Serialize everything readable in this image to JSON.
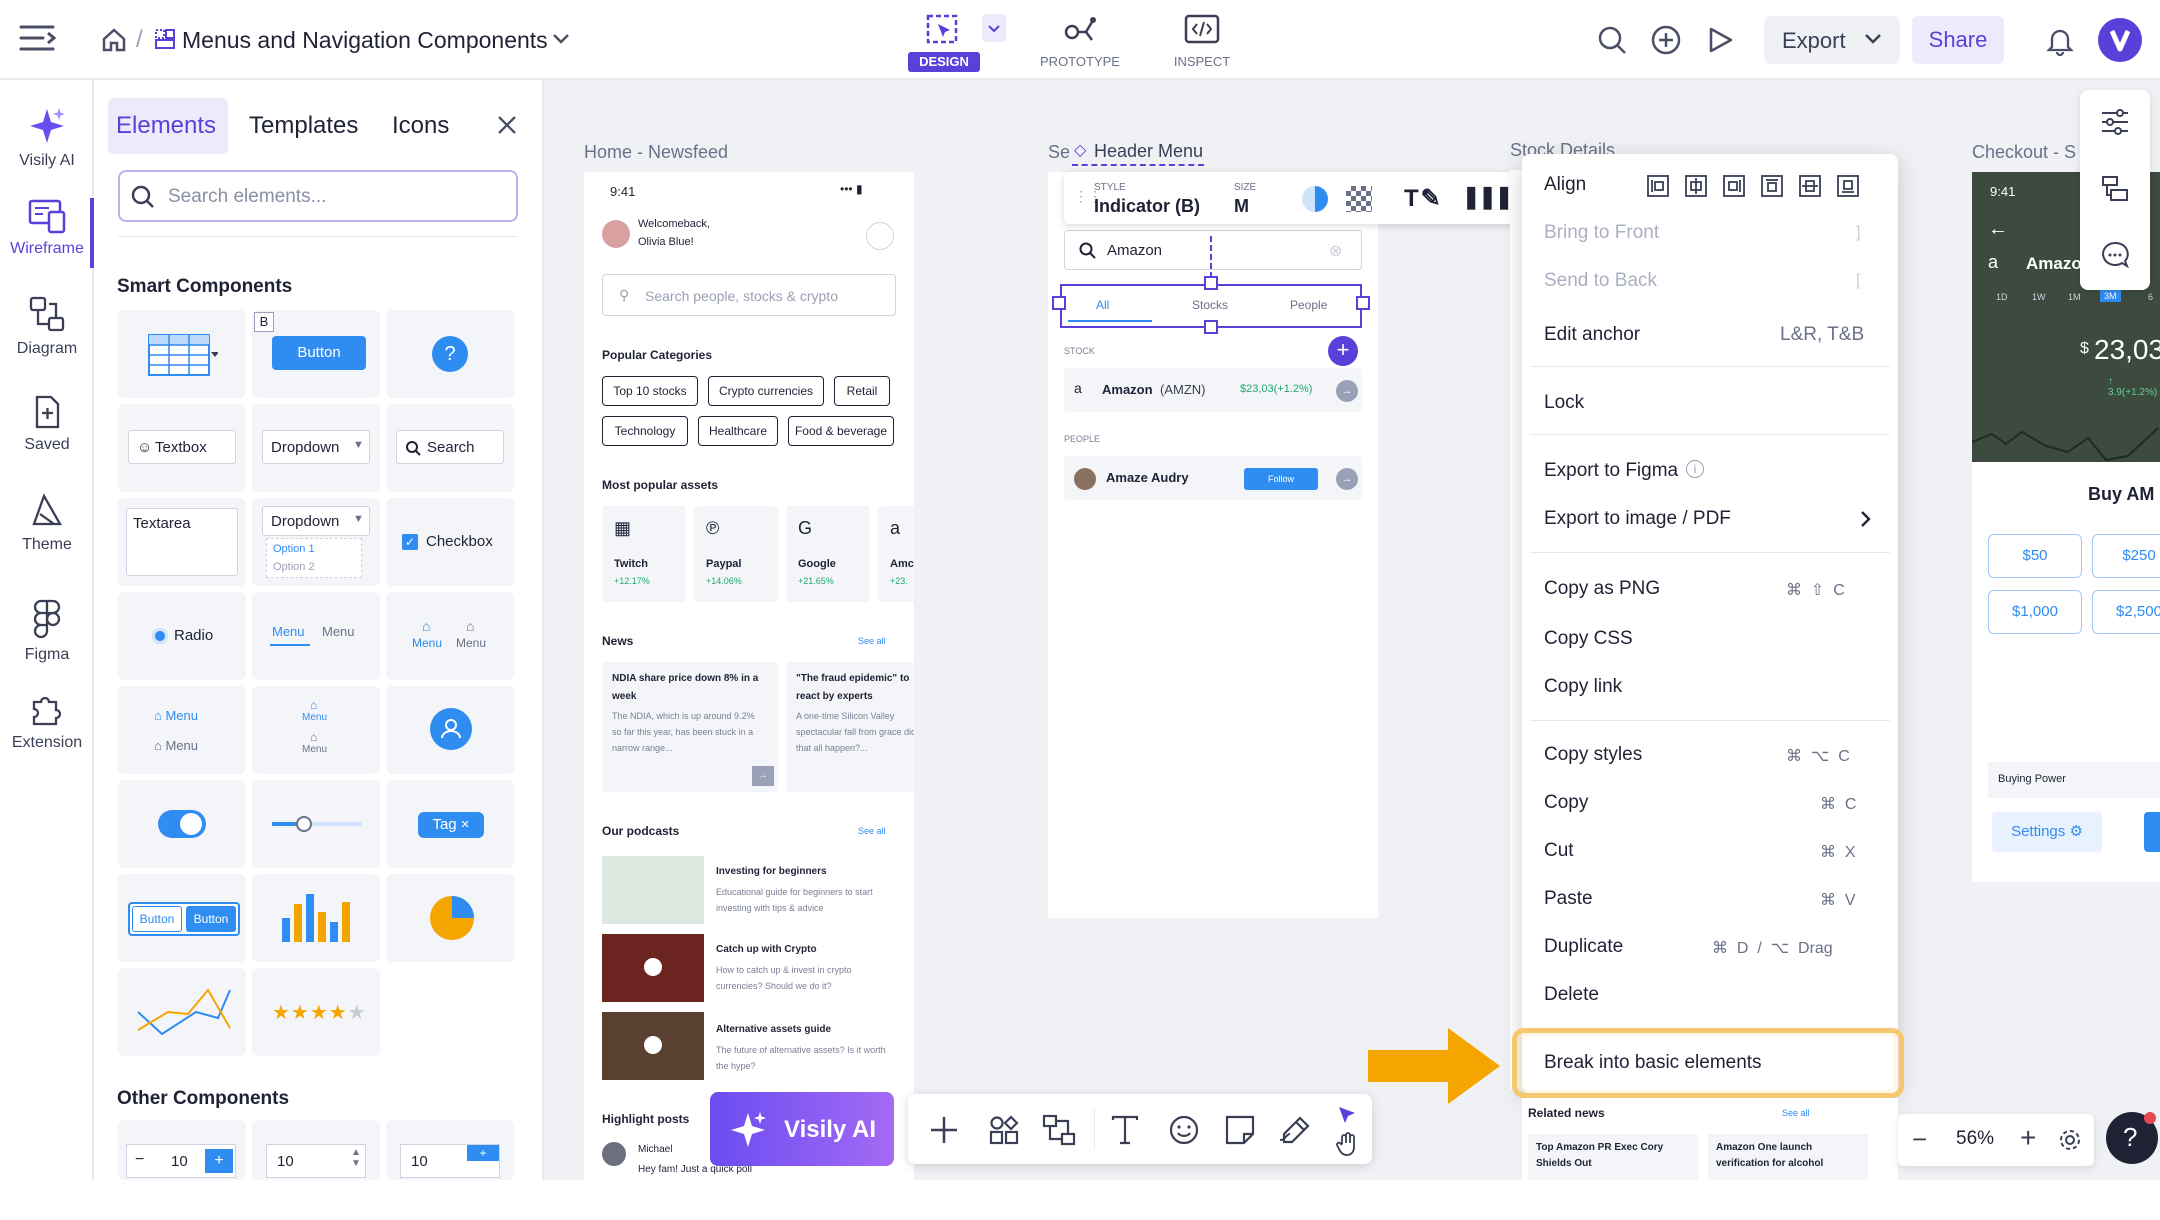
{
  "header": {
    "breadcrumb_title": "Menus and Navigation Components",
    "modes": [
      {
        "label": "DESIGN"
      },
      {
        "label": "PROTOTYPE"
      },
      {
        "label": "INSPECT"
      }
    ],
    "export_label": "Export",
    "share_label": "Share"
  },
  "rail": [
    {
      "label": "Visily AI",
      "icon": "sparkle-icon"
    },
    {
      "label": "Wireframe",
      "icon": "wireframe-icon"
    },
    {
      "label": "Diagram",
      "icon": "diagram-icon"
    },
    {
      "label": "Saved",
      "icon": "saved-icon"
    },
    {
      "label": "Theme",
      "icon": "theme-icon"
    },
    {
      "label": "Figma",
      "icon": "figma-icon"
    },
    {
      "label": "Extension",
      "icon": "extension-icon"
    }
  ],
  "panel": {
    "tabs": [
      "Elements",
      "Templates",
      "Icons"
    ],
    "search_placeholder": "Search elements...",
    "smart_components": "Smart Components",
    "other_components": "Other Components",
    "cells": {
      "b": "B",
      "button": "Button",
      "textbox": "Textbox",
      "dropdown": "Dropdown",
      "search": "Search",
      "textarea": "Textarea",
      "option1": "Option 1",
      "option2": "Option 2",
      "checkbox": "Checkbox",
      "radio": "Radio",
      "menu": "Menu",
      "tag": "Tag",
      "btn_button": "Button",
      "stepper": "10"
    }
  },
  "frames": {
    "newsfeed": {
      "label": "Home - Newsfeed",
      "time": "9:41",
      "welcome1": "Welcomeback,",
      "welcome2": "Olivia Blue!",
      "search": "Search people, stocks & crypto",
      "popular": "Popular Categories",
      "chips": [
        "Top 10 stocks",
        "Crypto currencies",
        "Retail",
        "Technology",
        "Healthcare",
        "Food & beverage"
      ],
      "assets_title": "Most popular assets",
      "assets": [
        {
          "name": "Twitch",
          "pct": "+12.17%"
        },
        {
          "name": "Paypal",
          "pct": "+14.06%"
        },
        {
          "name": "Google",
          "pct": "+21.65%"
        },
        {
          "name": "Amc",
          "pct": "+23."
        }
      ],
      "news_title": "News",
      "see_all": "See all",
      "news1_title": "NDIA share price down 8% in a week",
      "news1_body": "The NDIA, which is up around 9.2% so far this year, has been stuck in a narrow range...",
      "news2_title": "\"The fraud epidemic\" to react by experts",
      "news2_body": "A one-time Silicon Valley spectacular fall from grace did that all happen?...",
      "podcasts": "Our podcasts",
      "pods": [
        {
          "t": "Investing for beginners",
          "d": "Educational guide for beginners to start investing with tips & advice"
        },
        {
          "t": "Catch up with Crypto",
          "d": "How to catch up & invest in crypto currencies? Should we do it?"
        },
        {
          "t": "Alternative assets guide",
          "d": "The future of alternative assets? Is it worth the hype?"
        }
      ],
      "highlight": "Highlight posts",
      "post_user": "Michael",
      "post_text": "Hey fam! Just a quick poll"
    },
    "search": {
      "label_prefix": "Se",
      "header_menu": "Header Menu",
      "style_label": "STYLE",
      "style_value": "Indicator (B)",
      "size_label": "SIZE",
      "size_value": "M",
      "query": "Amazon",
      "tabs": [
        "All",
        "Stocks",
        "People"
      ],
      "stock_label": "STOCK",
      "stock_name": "Amazon",
      "stock_ticker": "(AMZN)",
      "stock_price": "$23,03(+1.2%)",
      "people_label": "PEOPLE",
      "person": "Amaze Audry",
      "follow": "Follow"
    },
    "stock_label": "Stock Details",
    "checkout": {
      "label": "Checkout - S",
      "time": "9:41",
      "name": "Amazo",
      "range": [
        "1D",
        "1W",
        "1M",
        "3M",
        "6"
      ],
      "price": "23,03",
      "change": "3.9(+1.2%)",
      "buy": "Buy AM",
      "amounts": [
        "$50",
        "$250",
        "$1,000",
        "$2,500"
      ],
      "power": "Buying Power",
      "settings": "Settings"
    }
  },
  "context_menu": {
    "align": "Align",
    "bring_front": "Bring to Front",
    "send_back": "Send to Back",
    "edit_anchor": "Edit anchor",
    "anchor_val": "L&R, T&B",
    "lock": "Lock",
    "export_figma": "Export to Figma",
    "export_image": "Export to image / PDF",
    "copy_png": "Copy as PNG",
    "copy_css": "Copy CSS",
    "copy_link": "Copy link",
    "copy_styles": "Copy styles",
    "copy": "Copy",
    "cut": "Cut",
    "paste": "Paste",
    "duplicate": "Duplicate",
    "delete": "Delete",
    "break": "Break into basic elements",
    "dup_keys": "D",
    "drag": "Drag"
  },
  "news_bottom": {
    "related": "Related news",
    "see_all": "See all",
    "n1": "Top Amazon PR Exec Cory Shields Out",
    "n2": "Amazon One launch verification for alcohol"
  },
  "toolbar": {
    "ai": "Visily AI"
  },
  "zoom": "56%",
  "colors": {
    "accent": "#5b3fd9",
    "highlight": "#f5a500",
    "blue": "#2f8cf0"
  }
}
